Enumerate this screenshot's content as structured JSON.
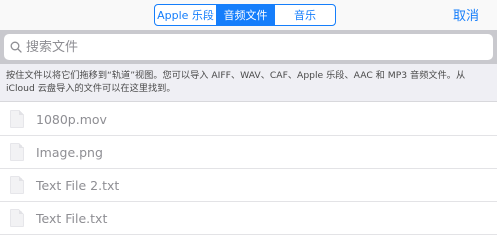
{
  "tabs": [
    {
      "label": "Apple 乐段"
    },
    {
      "label": "音频文件"
    },
    {
      "label": "音乐"
    }
  ],
  "active_tab": 1,
  "cancel_label": "取消",
  "search": {
    "placeholder": "搜索文件",
    "value": ""
  },
  "hint_text": "按住文件以将它们拖移到“轨道”视图。您可以导入 AIFF、WAV、CAF、Apple 乐段、AAC 和 MP3 音频文件。从 iCloud 云盘导入的文件可以在这里找到。",
  "files": [
    {
      "name": "1080p.mov"
    },
    {
      "name": "Image.png"
    },
    {
      "name": "Text File 2.txt"
    },
    {
      "name": "Text File.txt"
    }
  ],
  "colors": {
    "accent": "#157efb",
    "muted_text": "#8e8e93",
    "search_bar_bg": "#c9c9ce",
    "hint_bg": "#efeff4"
  },
  "icons": {
    "search": "search-icon",
    "file": "file-icon"
  }
}
